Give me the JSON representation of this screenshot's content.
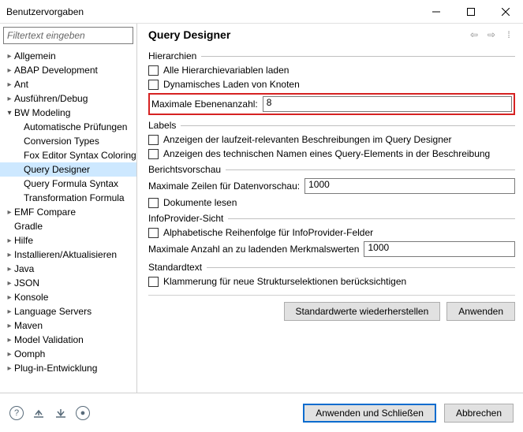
{
  "window": {
    "title": "Benutzervorgaben"
  },
  "filter": {
    "placeholder": "Filtertext eingeben"
  },
  "tree": {
    "items": [
      {
        "label": "Allgemein",
        "expandable": true,
        "open": false
      },
      {
        "label": "ABAP Development",
        "expandable": true,
        "open": false
      },
      {
        "label": "Ant",
        "expandable": true,
        "open": false
      },
      {
        "label": "Ausführen/Debug",
        "expandable": true,
        "open": false
      },
      {
        "label": "BW Modeling",
        "expandable": true,
        "open": true
      },
      {
        "label": "Automatische Prüfungen",
        "child": true
      },
      {
        "label": "Conversion Types",
        "child": true
      },
      {
        "label": "Fox Editor Syntax Coloring",
        "child": true
      },
      {
        "label": "Query Designer",
        "child": true,
        "selected": true
      },
      {
        "label": "Query Formula Syntax",
        "child": true
      },
      {
        "label": "Transformation Formula",
        "child": true
      },
      {
        "label": "EMF Compare",
        "expandable": true,
        "open": false
      },
      {
        "label": "Gradle",
        "expandable": false
      },
      {
        "label": "Hilfe",
        "expandable": true,
        "open": false
      },
      {
        "label": "Installieren/Aktualisieren",
        "expandable": true,
        "open": false
      },
      {
        "label": "Java",
        "expandable": true,
        "open": false
      },
      {
        "label": "JSON",
        "expandable": true,
        "open": false
      },
      {
        "label": "Konsole",
        "expandable": true,
        "open": false
      },
      {
        "label": "Language Servers",
        "expandable": true,
        "open": false
      },
      {
        "label": "Maven",
        "expandable": true,
        "open": false
      },
      {
        "label": "Model Validation",
        "expandable": true,
        "open": false
      },
      {
        "label": "Oomph",
        "expandable": true,
        "open": false
      },
      {
        "label": "Plug-in-Entwicklung",
        "expandable": true,
        "open": false
      }
    ]
  },
  "page": {
    "title": "Query Designer",
    "hier": {
      "legend": "Hierarchien",
      "cb1": "Alle Hierarchievariablen laden",
      "cb2": "Dynamisches Laden von Knoten",
      "maxLevelsLabel": "Maximale Ebenenanzahl:",
      "maxLevelsValue": "8"
    },
    "labels": {
      "legend": "Labels",
      "cb1": "Anzeigen der laufzeit-relevanten Beschreibungen im Query Designer",
      "cb2": "Anzeigen des technischen Namen eines Query-Elements in der Beschreibung"
    },
    "preview": {
      "legend": "Berichtsvorschau",
      "rowsLabel": "Maximale Zeilen für Datenvorschau:",
      "rowsValue": "1000",
      "cb1": "Dokumente lesen"
    },
    "info": {
      "legend": "InfoProvider-Sicht",
      "cb1": "Alphabetische Reihenfolge für InfoProvider-Felder",
      "maxLabel": "Maximale Anzahl an zu ladenden Merkmalswerten",
      "maxValue": "1000"
    },
    "std": {
      "legend": "Standardtext",
      "cb1": "Klammerung für neue Strukturselektionen berücksichtigen"
    },
    "restore": "Standardwerte wiederherstellen",
    "apply": "Anwenden"
  },
  "footer": {
    "applyClose": "Anwenden und Schließen",
    "cancel": "Abbrechen"
  }
}
